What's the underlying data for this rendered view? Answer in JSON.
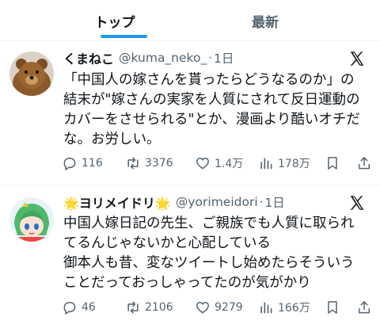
{
  "tabs": [
    {
      "label": "トップ",
      "active": true
    },
    {
      "label": "最新",
      "active": false
    }
  ],
  "accent_color": "#1d9bf0",
  "tweets": [
    {
      "name": "くまねこ",
      "handle": "@kuma_neko_",
      "separator": "·",
      "time": "1日",
      "lines": [
        "「中国人の嫁さんを貰ったらどうなるのか」の",
        "結末が\"嫁さんの実家を人質にされて反日運動の",
        "カバーをさせられる\"とか、漫画より酷いオチだ",
        "な。お労しい。"
      ],
      "stats": {
        "replies": "116",
        "retweets": "3376",
        "likes": "1.4万",
        "views": "178万"
      }
    },
    {
      "name": "🌟ヨリメイドリ🌟",
      "handle": "@yorimeidori",
      "separator": "·",
      "time": "1日",
      "lines": [
        "中国人嫁日記の先生、ご親族でも人質に取られ",
        "てるんじゃないかと心配している",
        "御本人も昔、変なツイートし始めたらそういう",
        "ことだっておっしゃってたのが気がかり"
      ],
      "stats": {
        "replies": "46",
        "retweets": "2106",
        "likes": "9279",
        "views": "166万"
      }
    }
  ]
}
